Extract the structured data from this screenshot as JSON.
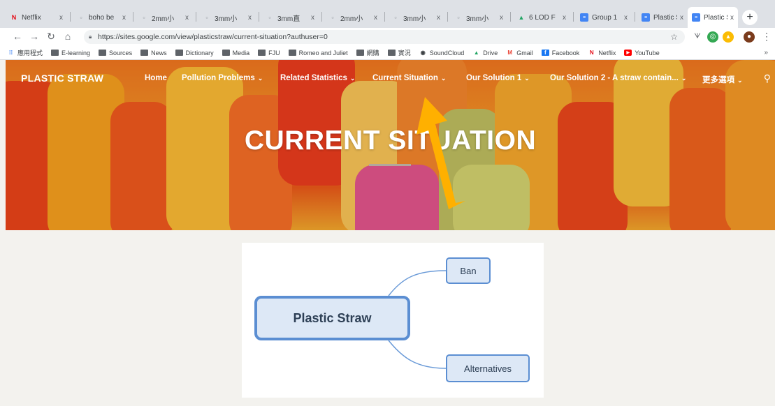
{
  "tabs": [
    {
      "label": "Netflix",
      "icon": "netflix-icon",
      "active": false
    },
    {
      "label": "boho be",
      "icon": "page-icon",
      "active": false
    },
    {
      "label": "2mm小",
      "icon": "page-icon",
      "active": false
    },
    {
      "label": "3mm小",
      "icon": "page-icon",
      "active": false
    },
    {
      "label": "3mm直",
      "icon": "page-icon",
      "active": false
    },
    {
      "label": "2mm小",
      "icon": "page-icon",
      "active": false
    },
    {
      "label": "3mm小",
      "icon": "page-icon",
      "active": false
    },
    {
      "label": "3mm小",
      "icon": "page-icon",
      "active": false
    },
    {
      "label": "6 LOD F",
      "icon": "drive-icon",
      "active": false
    },
    {
      "label": "Group 1",
      "icon": "sites-icon",
      "active": false
    },
    {
      "label": "Plastic S",
      "icon": "sites-icon",
      "active": false
    },
    {
      "label": "Plastic S",
      "icon": "sites-icon",
      "active": true
    }
  ],
  "tab_close": "x",
  "new_tab": "+",
  "address": {
    "url": "https://sites.google.com/view/plasticstraw/current-situation?authuser=0"
  },
  "bookmarks": [
    {
      "label": "應用程式",
      "icon": "apps-icon"
    },
    {
      "label": "E-learning",
      "icon": "folder-icon"
    },
    {
      "label": "Sources",
      "icon": "folder-icon"
    },
    {
      "label": "News",
      "icon": "folder-icon"
    },
    {
      "label": "Dictionary",
      "icon": "folder-icon"
    },
    {
      "label": "Media",
      "icon": "folder-icon"
    },
    {
      "label": "FJU",
      "icon": "folder-icon"
    },
    {
      "label": "Romeo and Juliet",
      "icon": "folder-icon"
    },
    {
      "label": "網購",
      "icon": "folder-icon"
    },
    {
      "label": "實況",
      "icon": "folder-icon"
    },
    {
      "label": "SoundCloud",
      "icon": "soundcloud-icon"
    },
    {
      "label": "Drive",
      "icon": "drive-icon"
    },
    {
      "label": "Gmail",
      "icon": "gmail-icon"
    },
    {
      "label": "Facebook",
      "icon": "facebook-icon"
    },
    {
      "label": "Netflix",
      "icon": "netflix-icon"
    },
    {
      "label": "YouTube",
      "icon": "youtube-icon"
    }
  ],
  "bookmarks_more": "»",
  "site": {
    "logo": "PLASTIC STRAW",
    "nav": [
      {
        "label": "Home",
        "dropdown": false
      },
      {
        "label": "Pollution Problems",
        "dropdown": true
      },
      {
        "label": "Related Statistics",
        "dropdown": true
      },
      {
        "label": "Current Situation",
        "dropdown": true
      },
      {
        "label": "Our Solution 1",
        "dropdown": true
      },
      {
        "label": "Our Solution 2 - A straw contain...",
        "dropdown": true
      },
      {
        "label": "更多選項",
        "dropdown": true
      }
    ],
    "hero_title": "CURRENT SITUATION"
  },
  "mindmap": {
    "root": "Plastic Straw",
    "branches": [
      "Ban",
      "Alternatives"
    ]
  },
  "colors": {
    "arrow": "#ffb000",
    "node_border": "#5b8ed2",
    "node_fill": "#dde8f6"
  }
}
